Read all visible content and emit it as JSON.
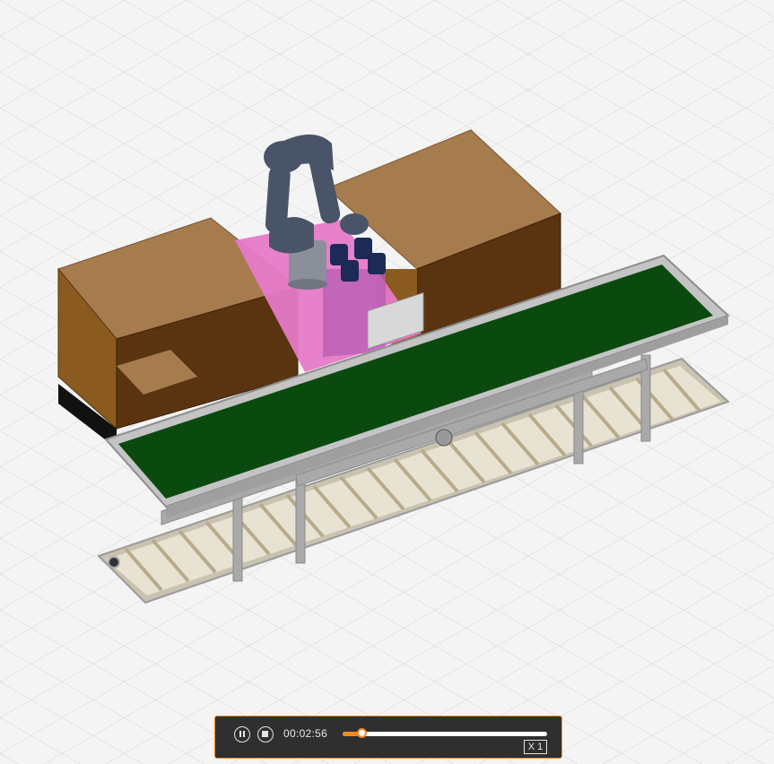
{
  "scene": {
    "grid_color": "#d9d9d9",
    "background_color": "#f4f4f4",
    "objects": [
      "robot-arm",
      "gripper",
      "box-stack-left",
      "box-stack-right",
      "pallet-area",
      "belt-conveyor",
      "roller-conveyor"
    ],
    "colors": {
      "box_top": "#a67b4e",
      "box_side_light": "#8b5a1e",
      "box_side_dark": "#5a3410",
      "pallet_pink": "#e67ac8",
      "belt_green": "#0b4a0f",
      "robot_blue": "#4a5468",
      "gripper_navy": "#1c2a55",
      "frame_gray": "#b8b8b8"
    }
  },
  "player": {
    "pause_icon": "pause-icon",
    "stop_icon": "stop-icon",
    "time": "00:02:56",
    "progress": 0.09,
    "speed_label": "X 1",
    "accent_color": "#f08a24",
    "background_color": "#2f2f2f"
  }
}
